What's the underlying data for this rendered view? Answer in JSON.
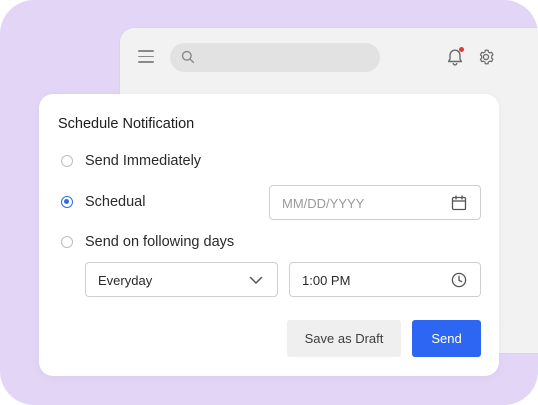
{
  "app": {
    "search": {
      "value": "",
      "placeholder": ""
    },
    "icons": {
      "menu": "hamburger-menu-icon",
      "search": "search-icon",
      "notifications": "bell-icon",
      "settings": "gear-icon"
    },
    "notification_dot_color": "#e53935"
  },
  "dialog": {
    "title": "Schedule Notification",
    "options": [
      {
        "label": "Send Immediately",
        "checked": false
      },
      {
        "label": "Schedual",
        "checked": true
      },
      {
        "label": "Send on following days",
        "checked": false
      }
    ],
    "date": {
      "value": "",
      "placeholder": "MM/DD/YYYY",
      "icon": "calendar-icon"
    },
    "repeat": {
      "selected": "Everyday",
      "icon": "chevron-down-icon"
    },
    "time": {
      "value": "1:00 PM",
      "icon": "clock-icon"
    },
    "buttons": {
      "draft_label": "Save as Draft",
      "send_label": "Send"
    }
  },
  "colors": {
    "background": "#e3d5f6",
    "accent": "#2d66f2",
    "radio_selected": "#2f6bea"
  }
}
